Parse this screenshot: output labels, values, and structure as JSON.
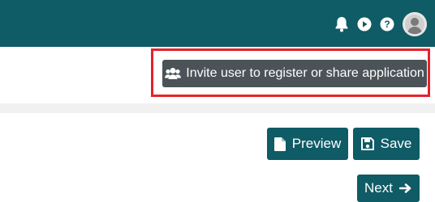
{
  "colors": {
    "topbar": "#0f5b66",
    "primary_button": "#0f5b66",
    "invite_button": "#4b5358",
    "highlight": "#e3232b",
    "gray_band": "#f1f1f1"
  },
  "topbar": {
    "icons": [
      "bell-icon",
      "play-circle-icon",
      "help-circle-icon",
      "user-avatar-icon"
    ]
  },
  "invite": {
    "label": "Invite user to register or share application",
    "icon": "users-icon"
  },
  "actions": {
    "preview_label": "Preview",
    "preview_icon": "document-icon",
    "save_label": "Save",
    "save_icon": "floppy-disk-icon",
    "next_label": "Next",
    "next_icon": "arrow-right-icon"
  }
}
